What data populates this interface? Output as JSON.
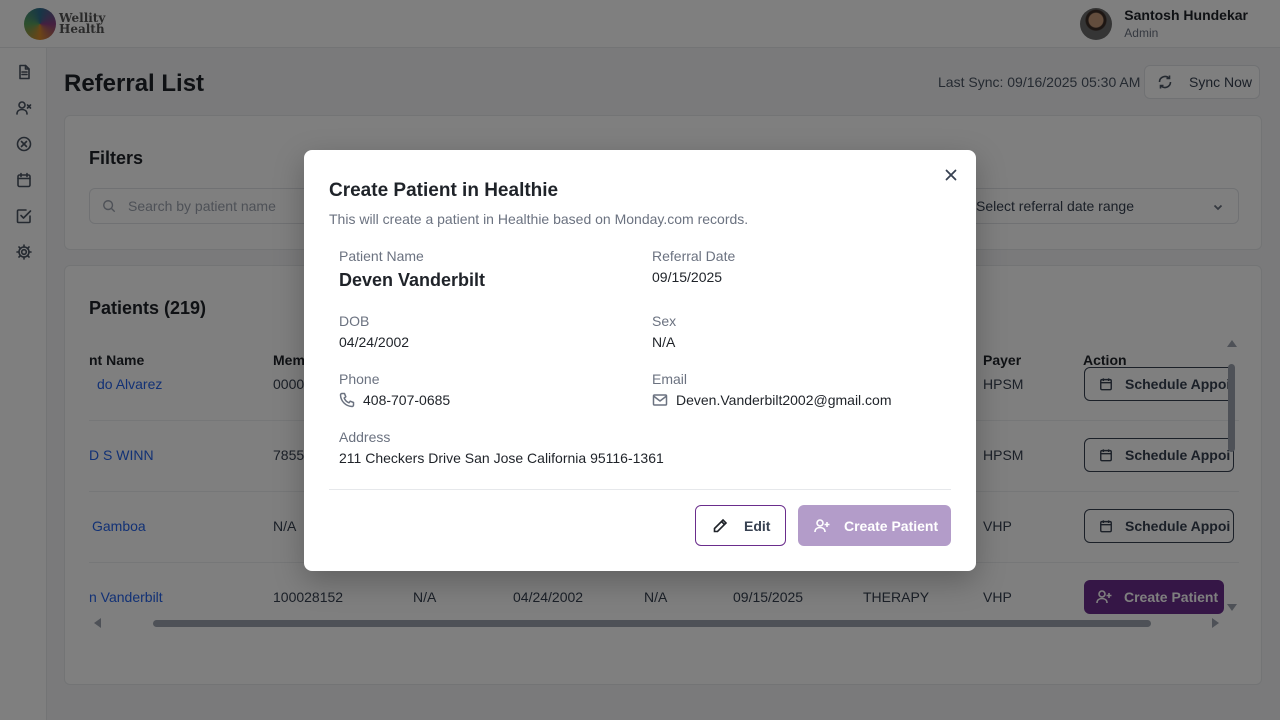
{
  "app": {
    "logo_text_line1": "Wellity",
    "logo_text_line2": "Health"
  },
  "user": {
    "name": "Santosh Hundekar",
    "role": "Admin"
  },
  "sidebar": {
    "items": [
      {
        "icon": "document-icon"
      },
      {
        "icon": "user-x-icon"
      },
      {
        "icon": "circle-x-icon"
      },
      {
        "icon": "calendar-icon"
      },
      {
        "icon": "check-square-icon"
      },
      {
        "icon": "gear-icon"
      }
    ]
  },
  "header": {
    "title": "Referral List",
    "last_sync": "Last Sync: 09/16/2025 05:30 AM",
    "sync_button": "Sync Now"
  },
  "filters": {
    "title": "Filters",
    "search_placeholder": "Search by patient name",
    "date_range_placeholder": "Select referral date range"
  },
  "patients": {
    "title": "Patients (219)",
    "columns": {
      "name": "nt Name",
      "member": "Mem",
      "payer": "Payer",
      "action": "Action"
    },
    "rows": [
      {
        "name": "do Alvarez",
        "member": "0000",
        "payer": "HPSM",
        "action": "Schedule Appoi"
      },
      {
        "name": "D S WINN",
        "member": "7855",
        "payer": "HPSM",
        "action": "Schedule Appoi"
      },
      {
        "name": "Gamboa",
        "member": "N/A",
        "payer": "VHP",
        "action": "Schedule Appoi"
      },
      {
        "name": "n Vanderbilt",
        "member": "100028152",
        "c3": "N/A",
        "dob": "04/24/2002",
        "sex": "N/A",
        "referral_date": "09/15/2025",
        "type": "THERAPY",
        "payer": "VHP",
        "action": "Create Patient"
      }
    ]
  },
  "modal": {
    "title": "Create Patient in Healthie",
    "subtitle": "This will create a patient in Healthie based on Monday.com records.",
    "patient_name_label": "Patient Name",
    "patient_name": "Deven Vanderbilt",
    "referral_date_label": "Referral Date",
    "referral_date": "09/15/2025",
    "dob_label": "DOB",
    "dob": "04/24/2002",
    "sex_label": "Sex",
    "sex": "N/A",
    "phone_label": "Phone",
    "phone": "408-707-0685",
    "email_label": "Email",
    "email": "Deven.Vanderbilt2002@gmail.com",
    "address_label": "Address",
    "address": "211 Checkers Drive San Jose California 95116-1361",
    "edit_button": "Edit",
    "create_button": "Create Patient"
  },
  "colors": {
    "brand_purple": "#6a2d8c",
    "disabled_purple": "#b39cc9",
    "link_blue": "#2563eb"
  }
}
